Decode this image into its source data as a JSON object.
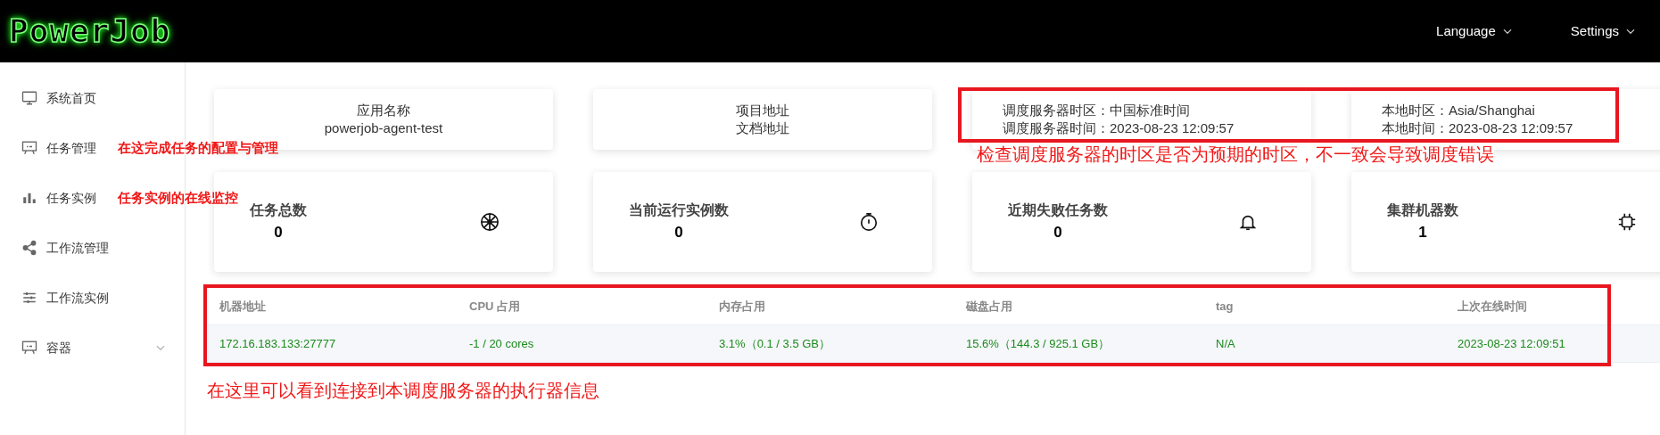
{
  "header": {
    "logo": "PowerJob",
    "menus": [
      {
        "label": "Language"
      },
      {
        "label": "Settings"
      }
    ]
  },
  "sidebar": {
    "items": [
      {
        "label": "系统首页"
      },
      {
        "label": "任务管理"
      },
      {
        "label": "任务实例"
      },
      {
        "label": "工作流管理"
      },
      {
        "label": "工作流实例"
      },
      {
        "label": "容器",
        "expanded": false
      }
    ]
  },
  "info_cards": [
    {
      "lines": [
        "应用名称",
        "powerjob-agent-test"
      ]
    },
    {
      "lines": [
        "项目地址",
        "文档地址"
      ]
    },
    {
      "lines": [
        "调度服务器时区：中国标准时间",
        "调度服务器时间：2023-08-23 12:09:57"
      ]
    },
    {
      "lines": [
        "本地时区：Asia/Shanghai",
        "本地时间：2023-08-23 12:09:57"
      ]
    }
  ],
  "stat_cards": [
    {
      "label": "任务总数",
      "value": "0"
    },
    {
      "label": "当前运行实例数",
      "value": "0"
    },
    {
      "label": "近期失败任务数",
      "value": "0"
    },
    {
      "label": "集群机器数",
      "value": "1"
    }
  ],
  "table": {
    "columns": [
      "机器地址",
      "CPU 占用",
      "内存占用",
      "磁盘占用",
      "tag",
      "上次在线时间"
    ],
    "rows": [
      [
        "172.16.183.133:27777",
        "-1 / 20 cores",
        "3.1%（0.1 / 3.5 GB）",
        "15.6%（144.3 / 925.1 GB）",
        "N/A",
        "2023-08-23 12:09:51"
      ]
    ]
  },
  "annotations": [
    {
      "text": "在这完成任务的配置与管理"
    },
    {
      "text": "任务实例的在线监控"
    },
    {
      "text": "检查调度服务器的时区是否为预期的时区，不一致会导致调度错误"
    },
    {
      "text": "在这里可以看到连接到本调度服务器的执行器信息"
    }
  ]
}
